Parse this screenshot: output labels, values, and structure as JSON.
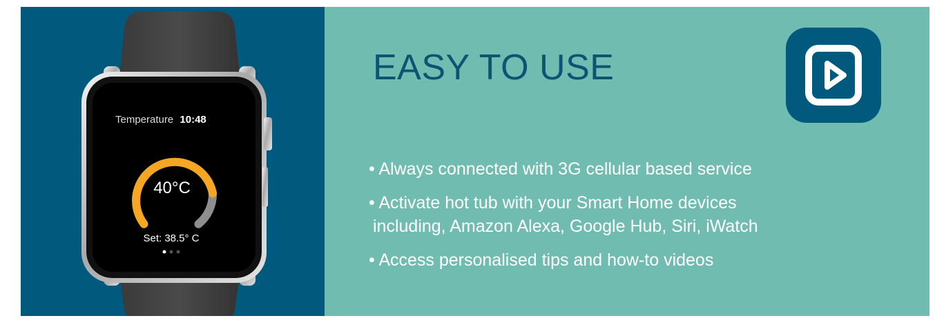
{
  "watch": {
    "title": "Temperature",
    "time": "10:48",
    "temperature": "40°C",
    "set_point": "Set: 38.5° C",
    "page_indicator": {
      "pages": 3,
      "active": 1
    }
  },
  "heading": "EASY TO USE",
  "app_icon": "play-video-icon",
  "features": [
    {
      "line1": "Always connected with 3G cellular based service",
      "line2": ""
    },
    {
      "line1": "Activate hot tub with your Smart Home devices",
      "line2": "including, Amazon Alexa, Google Hub, Siri, iWatch"
    },
    {
      "line1": "Access personalised tips and how-to videos",
      "line2": ""
    }
  ],
  "bullet": "•",
  "colors": {
    "left_panel": "#015a7e",
    "right_panel": "#71bcb0",
    "heading": "#0d5372",
    "gauge": "#f5a623",
    "gauge_remainder": "#8e8e8e"
  }
}
